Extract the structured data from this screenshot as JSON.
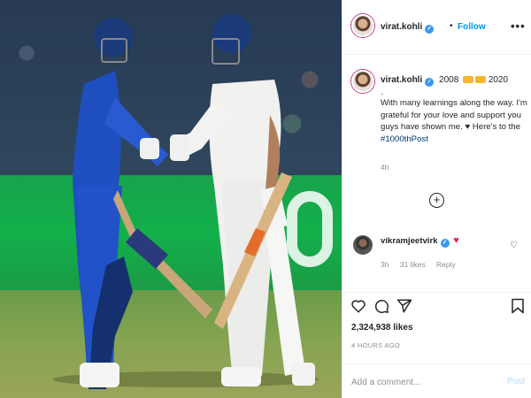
{
  "post": {
    "author": "virat.kohli",
    "follow_label": "Follow",
    "header_separator": "•",
    "more_label": "•••",
    "caption_year_range": "2008",
    "caption_year_end": "2020",
    "caption_dot": ".",
    "caption_text": "With many learnings along the way. I'm grateful for your love and support you guys have shown me. ♥ Here's to the",
    "caption_hashtag": "#1000thPost",
    "caption_time": "4h",
    "load_more_label": "+"
  },
  "comment": {
    "author": "vikramjeetvirk",
    "text": "♥",
    "time": "3h",
    "likes": "31 likes",
    "reply_label": "Reply"
  },
  "footer": {
    "likes_count": "2,324,938 likes",
    "posted_ago": "4 HOURS AGO",
    "comment_placeholder": "Add a comment...",
    "post_label": "Post"
  },
  "colors": {
    "accent": "#0095f6",
    "verified": "#3897f0",
    "muted": "#8e8e8e",
    "post_disabled": "#b2dffc"
  },
  "icons": [
    "verified-icon",
    "more-icon",
    "add-circle-icon",
    "heart-icon",
    "comment-icon",
    "share-icon",
    "bookmark-icon",
    "heart-emoji-icon"
  ]
}
